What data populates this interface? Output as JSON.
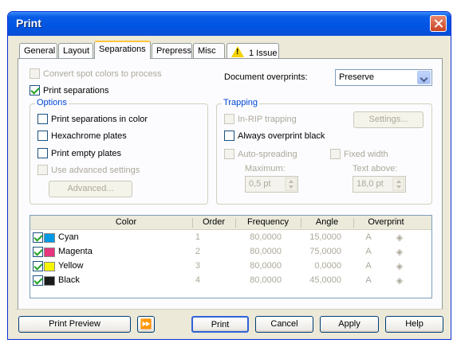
{
  "window": {
    "title": "Print"
  },
  "tabs": [
    {
      "label": "General"
    },
    {
      "label": "Layout"
    },
    {
      "label": "Separations"
    },
    {
      "label": "Prepress"
    },
    {
      "label": "Misc"
    },
    {
      "label": "1 Issue"
    }
  ],
  "top": {
    "convert_spot_label": "Convert spot colors to process",
    "print_separations_label": "Print separations",
    "document_overprints_label": "Document overprints:",
    "document_overprints_value": "Preserve"
  },
  "options": {
    "legend": "Options",
    "print_in_color": "Print separations in color",
    "hexachrome": "Hexachrome plates",
    "print_empty": "Print empty plates",
    "advanced_settings": "Use advanced settings",
    "advanced_button": "Advanced..."
  },
  "trapping": {
    "legend": "Trapping",
    "in_rip": "In-RIP trapping",
    "settings_button": "Settings...",
    "always_overprint_black": "Always overprint black",
    "auto_spreading": "Auto-spreading",
    "fixed_width": "Fixed width",
    "maximum_label": "Maximum:",
    "maximum_value": "0,5 pt",
    "text_above_label": "Text above:",
    "text_above_value": "18,0 pt"
  },
  "table": {
    "headers": [
      "Color",
      "Order",
      "Frequency",
      "Angle",
      "Overprint"
    ],
    "rows": [
      {
        "name": "Cyan",
        "color": "#0099e6",
        "order": "1",
        "frequency": "80,0000",
        "angle": "15,0000"
      },
      {
        "name": "Magenta",
        "color": "#e6347d",
        "order": "2",
        "frequency": "80,0000",
        "angle": "75,0000"
      },
      {
        "name": "Yellow",
        "color": "#f5f500",
        "order": "3",
        "frequency": "80,0000",
        "angle": "0,0000"
      },
      {
        "name": "Black",
        "color": "#1a1a1a",
        "order": "4",
        "frequency": "80,0000",
        "angle": "45,0000"
      }
    ]
  },
  "buttons": {
    "print_preview": "Print Preview",
    "print": "Print",
    "cancel": "Cancel",
    "apply": "Apply",
    "help": "Help"
  }
}
